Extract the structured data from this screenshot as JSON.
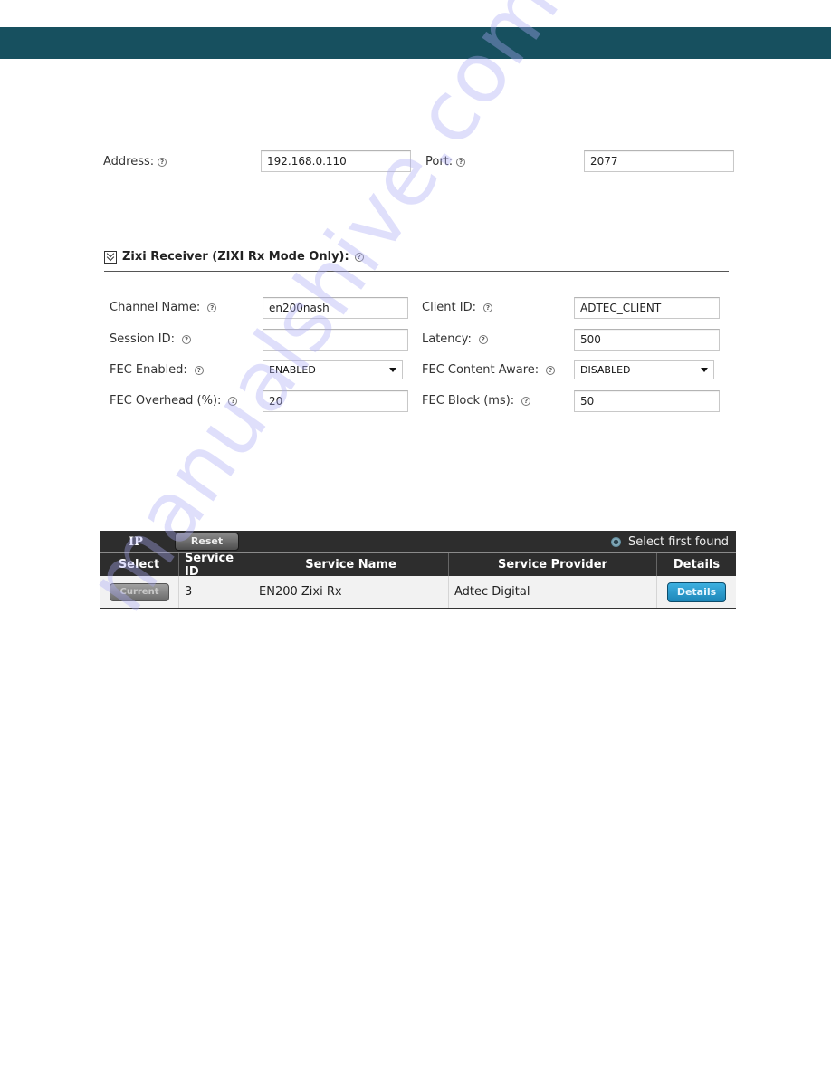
{
  "network": {
    "address_label": "Address:",
    "address_value": "192.168.0.110",
    "port_label": "Port:",
    "port_value": "2077"
  },
  "zixi_section": {
    "title": "Zixi Receiver (ZIXI Rx Mode Only):",
    "fields": {
      "channel_name": {
        "label": "Channel Name:",
        "value": "en200nash"
      },
      "client_id": {
        "label": "Client ID:",
        "value": "ADTEC_CLIENT"
      },
      "session_id": {
        "label": "Session ID:",
        "value": ""
      },
      "latency": {
        "label": "Latency:",
        "value": "500"
      },
      "fec_enabled": {
        "label": "FEC Enabled:",
        "value": "ENABLED"
      },
      "fec_content_aware": {
        "label": "FEC Content Aware:",
        "value": "DISABLED"
      },
      "fec_overhead": {
        "label": "FEC Overhead (%):",
        "value": "20"
      },
      "fec_block": {
        "label": "FEC Block (ms):",
        "value": "50"
      }
    }
  },
  "help_glyph": "?",
  "services_table": {
    "source_label": "IP",
    "reset_label": "Reset",
    "select_first_found_label": "Select first found",
    "columns": [
      "Select",
      "Service ID",
      "Service Name",
      "Service Provider",
      "Details"
    ],
    "rows": [
      {
        "select_label": "Current",
        "service_id": "3",
        "service_name": "EN200 Zixi Rx",
        "service_provider": "Adtec Digital",
        "details_label": "Details"
      }
    ]
  },
  "colors": {
    "top_band": "#17505f",
    "table_header": "#2d2d2d",
    "details_button": "#2596c9"
  },
  "watermark": "manualshive.com"
}
